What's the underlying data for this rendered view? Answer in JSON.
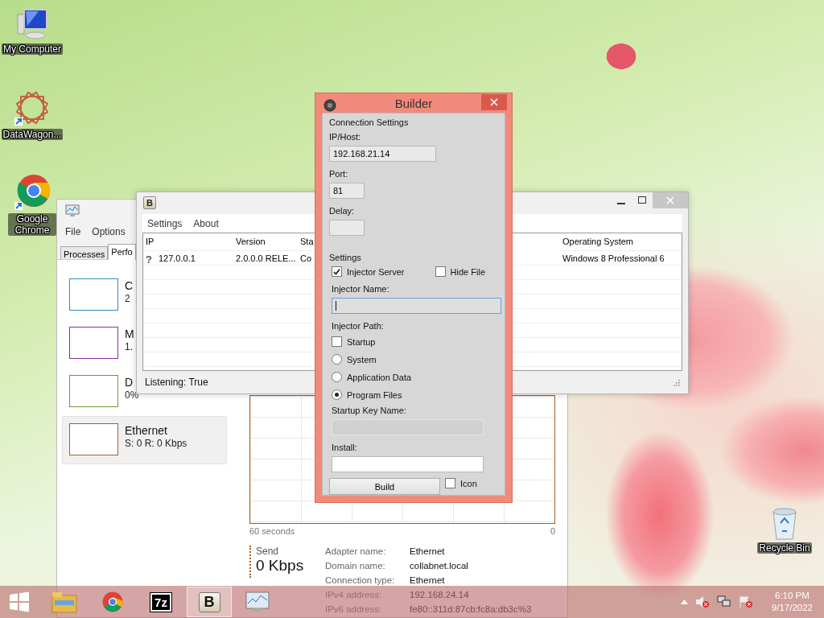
{
  "desktop_icons": [
    {
      "kind": "computer",
      "label": "My Computer"
    },
    {
      "kind": "star",
      "label": "DataWagon..."
    },
    {
      "kind": "chrome",
      "label": "Google Chrome"
    }
  ],
  "recycle_bin": {
    "label": "Recycle Bin"
  },
  "task_manager": {
    "menu": [
      "File",
      "Options"
    ],
    "tabs": [
      {
        "label": "Processes",
        "selected": false
      },
      {
        "label": "Perfo",
        "selected": true
      }
    ],
    "resources": [
      {
        "name": "C",
        "reading": "2",
        "color": "#2b8fc0",
        "selected": false
      },
      {
        "name": "M",
        "reading": "1.",
        "color": "#8b2f9c",
        "selected": false
      },
      {
        "name": "D",
        "reading": "0%",
        "color": "#6f9c2b",
        "selected": false
      },
      {
        "name": "Ethernet",
        "reading": "S: 0 R: 0 Kbps",
        "color": "#a0612a",
        "selected": true
      }
    ],
    "graph": {
      "start_label": "60 seconds",
      "end_label": "0"
    },
    "send": {
      "label": "Send",
      "value": "0 Kbps"
    },
    "details": [
      {
        "label": "Adapter name:",
        "value": "Ethernet"
      },
      {
        "label": "Domain name:",
        "value": "collabnet.local"
      },
      {
        "label": "Connection type:",
        "value": "Ethernet"
      },
      {
        "label": "IPv4 address:",
        "value": "192.168.24.14"
      },
      {
        "label": "IPv6 address:",
        "value": "fe80::311d:87cb:fc8a:db3c%3"
      }
    ]
  },
  "server_window": {
    "app_badge": "B",
    "menu": [
      "Settings",
      "About"
    ],
    "columns": [
      "IP",
      "Version",
      "Sta",
      "Operating System"
    ],
    "rows": [
      {
        "icon": "?",
        "cells": [
          "127.0.0.1",
          "2.0.0.0 RELE...",
          "Co",
          "Windows 8 Professional 6"
        ]
      }
    ],
    "status": "Listening: True"
  },
  "builder": {
    "title": "Builder",
    "connection_heading": "Connection Settings",
    "fields": [
      {
        "label": "IP/Host:",
        "value": "192.168.21.14"
      },
      {
        "label": "Port:",
        "value": "81"
      },
      {
        "label": "Delay:"
      }
    ],
    "settings_heading": "Settings",
    "injector_server": {
      "label": "Injector Server",
      "checked": true
    },
    "hide_file": {
      "label": "Hide File",
      "checked": false
    },
    "injector_name": {
      "label": "Injector Name:",
      "focused": true
    },
    "path_label": "Injector Path:",
    "path_options": [
      {
        "kind": "checkbox",
        "label": "Startup",
        "checked": false
      },
      {
        "kind": "radio",
        "label": "System",
        "selected": false
      },
      {
        "kind": "radio",
        "label": "Application Data",
        "selected": false
      },
      {
        "kind": "radio",
        "label": "Program Files",
        "selected": true
      }
    ],
    "startup_key": {
      "label": "Startup Key Name:",
      "disabled": true
    },
    "install": {
      "label": "Install:",
      "disabled": false
    },
    "build_button": "Build",
    "icon_option": {
      "label": "Icon",
      "checked": false
    }
  },
  "taskbar": {
    "buttons": [
      {
        "kind": "folder",
        "active": false
      },
      {
        "kind": "chrome",
        "active": false
      },
      {
        "kind": "sevenzip",
        "label": "7z",
        "active": false
      },
      {
        "kind": "badge",
        "label": "B",
        "active": true
      },
      {
        "kind": "monitor",
        "active": false
      }
    ],
    "clock": {
      "time": "6:10 PM",
      "date": "9/17/2022"
    }
  }
}
